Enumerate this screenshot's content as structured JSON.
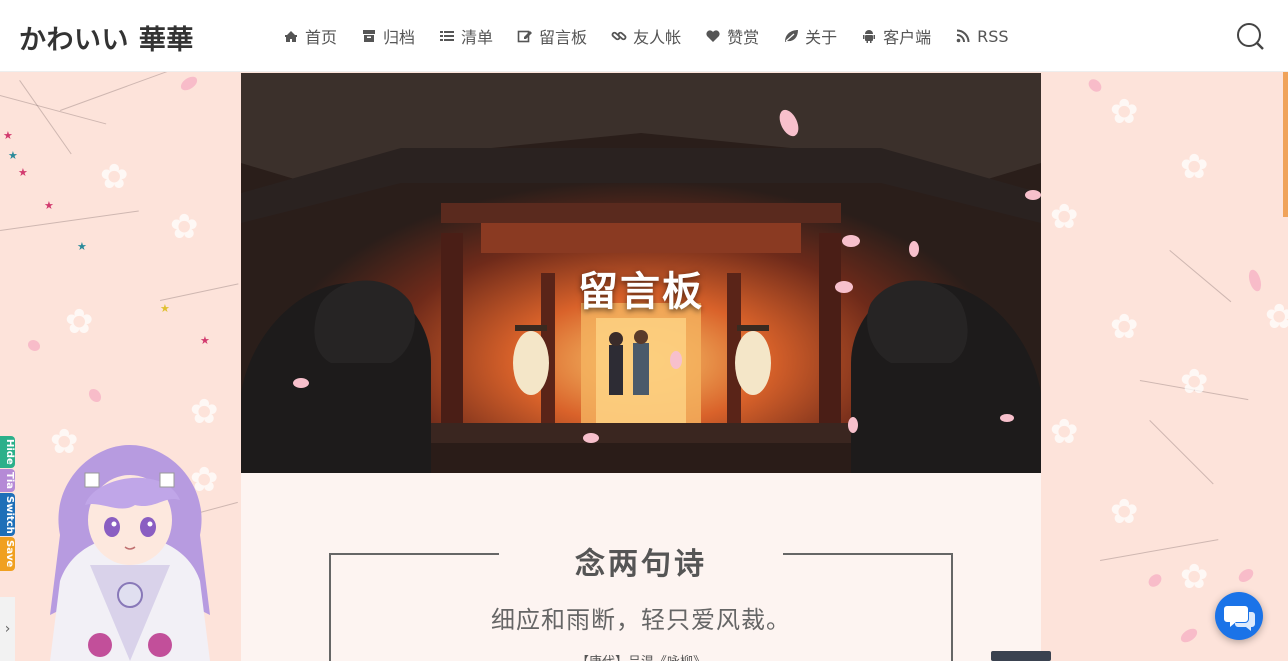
{
  "header": {
    "logo": "かわいい 華華",
    "nav": [
      {
        "label": "首页",
        "icon": "home-icon"
      },
      {
        "label": "归档",
        "icon": "archive-icon"
      },
      {
        "label": "清单",
        "icon": "list-icon"
      },
      {
        "label": "留言板",
        "icon": "edit-icon"
      },
      {
        "label": "友人帐",
        "icon": "link-icon"
      },
      {
        "label": "赞赏",
        "icon": "heart-icon"
      },
      {
        "label": "关于",
        "icon": "leaf-icon"
      },
      {
        "label": "客户端",
        "icon": "android-icon"
      },
      {
        "label": "RSS",
        "icon": "rss-icon"
      }
    ],
    "search_icon": "search-icon"
  },
  "hero": {
    "title": "留言板"
  },
  "poem": {
    "title": "念两句诗",
    "line": "细应和雨断，轻只爱风裁。",
    "source": "【唐代】吕温《咏柳》"
  },
  "side_tabs": [
    {
      "label": "Hide",
      "color": "#2bb08a"
    },
    {
      "label": "Tia",
      "color": "#b58ad6"
    },
    {
      "label": "Switch",
      "color": "#1e6fb8"
    },
    {
      "label": "Save",
      "color": "#f0a020"
    }
  ],
  "colors": {
    "background": "#fde3da",
    "accent_scroll": "#f0a35a",
    "chat_button": "#1a73e8"
  }
}
